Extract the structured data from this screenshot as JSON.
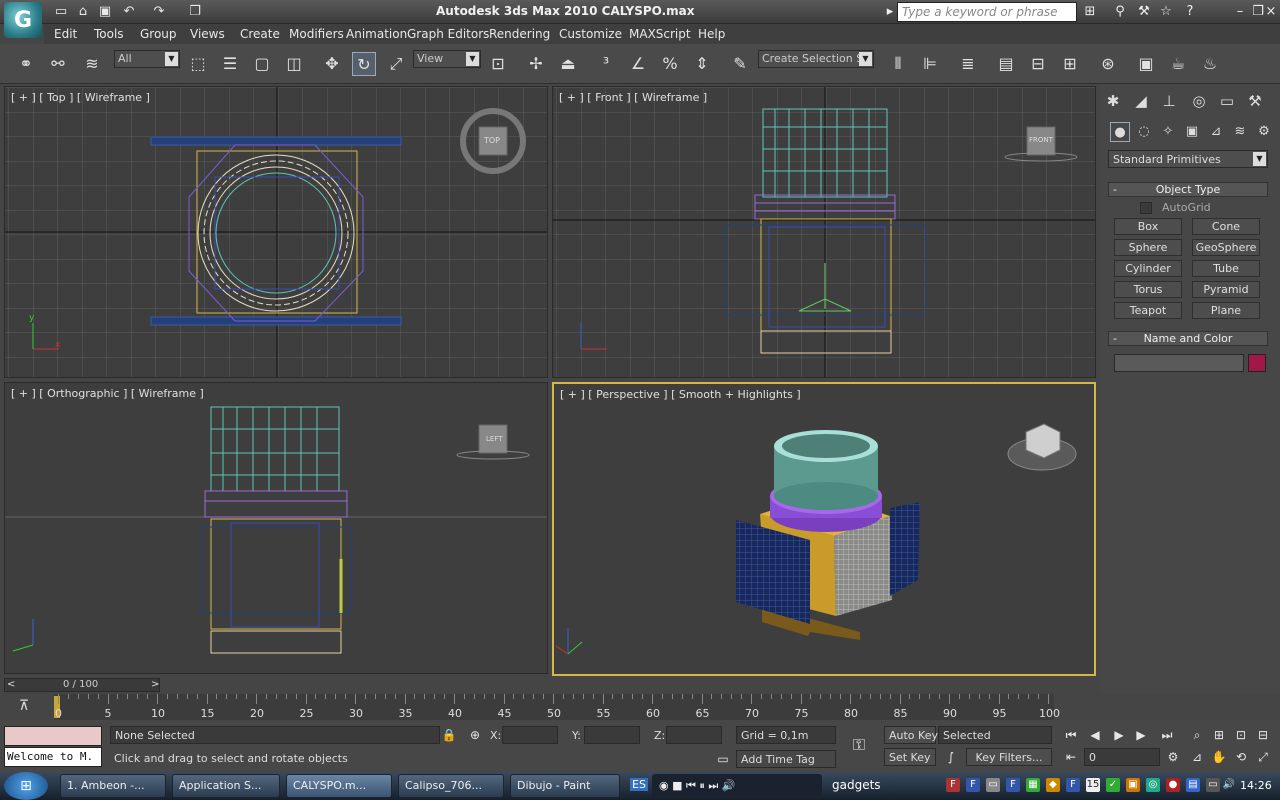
{
  "app": {
    "title": "Autodesk 3ds Max  2010      CALYSPO.max",
    "logo_icon": "3ds-max-logo"
  },
  "quick_access": [
    "new-icon",
    "open-icon",
    "save-icon",
    "undo-icon",
    "redo-icon",
    "project-icon"
  ],
  "search": {
    "placeholder": "Type a keyword or phrase"
  },
  "menu": [
    "Edit",
    "Tools",
    "Group",
    "Views",
    "Create",
    "Modifiers",
    "Animation",
    "Graph Editors",
    "Rendering",
    "Customize",
    "MAXScript",
    "Help"
  ],
  "toolbar": {
    "filter_dd": "All",
    "refcoord_dd": "View",
    "selset_dd": "Create Selection Se",
    "tools": [
      "select-link-icon",
      "unlink-icon",
      "bind-spacewarp-icon",
      "select-object-icon",
      "select-by-name-icon",
      "rect-region-icon",
      "window-crossing-icon",
      "move-icon",
      "rotate-icon",
      "scale-icon",
      "pivot-icon",
      "manipulate-icon",
      "snap-3-icon",
      "angle-snap-icon",
      "percent-snap-icon",
      "spinner-snap-icon",
      "edit-named-sets-icon",
      "mirror-icon",
      "align-icon",
      "layer-icon",
      "curve-editor-icon",
      "schematic-icon",
      "material-editor-icon",
      "render-setup-icon",
      "render-frame-icon",
      "render-icon"
    ]
  },
  "viewports": {
    "top": {
      "label": "[ + ] [ Top ] [ Wireframe ]",
      "cube": "TOP"
    },
    "front": {
      "label": "[ + ] [ Front ] [ Wireframe ]",
      "cube": "FRONT"
    },
    "ortho": {
      "label": "[ + ] [ Orthographic ] [ Wireframe ]",
      "cube": "LEFT"
    },
    "persp": {
      "label": "[ + ] [ Perspective ] [ Smooth + Highlights ]"
    }
  },
  "command_panel": {
    "tabs": [
      "create-icon",
      "modify-icon",
      "hierarchy-icon",
      "motion-icon",
      "display-icon",
      "utilities-icon"
    ],
    "subtabs": [
      "geometry-icon",
      "shapes-icon",
      "lights-icon",
      "cameras-icon",
      "helpers-icon",
      "spacewarps-icon",
      "systems-icon"
    ],
    "category": "Standard Primitives",
    "object_type_title": "Object Type",
    "autogrid": "AutoGrid",
    "buttons": [
      "Box",
      "Cone",
      "Sphere",
      "GeoSphere",
      "Cylinder",
      "Tube",
      "Torus",
      "Pyramid",
      "Teapot",
      "Plane"
    ],
    "name_color_title": "Name and Color",
    "color_swatch": "#a01848"
  },
  "timeline": {
    "frame": "0 / 100",
    "prev": "<",
    "next": ">",
    "ticks": [
      "0",
      "5",
      "10",
      "15",
      "20",
      "25",
      "30",
      "35",
      "40",
      "45",
      "50",
      "55",
      "60",
      "65",
      "70",
      "75",
      "80",
      "85",
      "90",
      "95",
      "100"
    ]
  },
  "status": {
    "maxscript": "Welcome to M.",
    "selection": "None Selected",
    "prompt": "Click and drag to select and rotate objects",
    "x_label": "X:",
    "y_label": "Y:",
    "z_label": "Z:",
    "grid": "Grid = 0,1m",
    "add_time_tag": "Add Time Tag",
    "auto_key": "Auto Key",
    "set_key": "Set Key",
    "selected_dd": "Selected",
    "key_filters": "Key Filters...",
    "frame_field": "0"
  },
  "taskbar": {
    "tasks": [
      "1. Ambeon -...",
      "Application S...",
      "CALYSPO.m...",
      "Calipso_706...",
      "Dibujo - Paint"
    ],
    "lang": "ES",
    "gadgets": "gadgets",
    "clock": "14:26"
  }
}
